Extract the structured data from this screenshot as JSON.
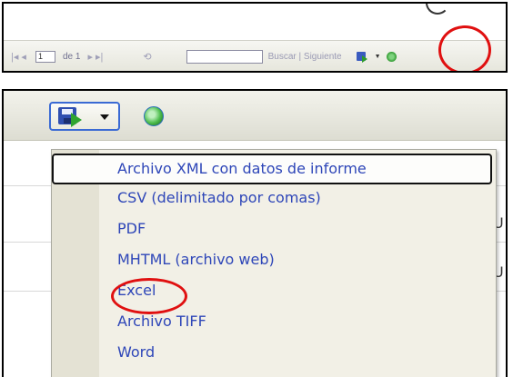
{
  "top_toolbar": {
    "nav_first_prev": "|◂  ◂",
    "page_value": "1",
    "page_of": "de 1",
    "nav_next_last": "▸  ▸|",
    "refresh_small": "⟲",
    "search_links": "Buscar | Siguiente"
  },
  "report_cells": {
    "row1_tail": "U",
    "row2_tail": "U"
  },
  "export_menu": {
    "items": [
      {
        "label": "Archivo XML con datos de informe"
      },
      {
        "label": "CSV (delimitado por comas)"
      },
      {
        "label": "PDF"
      },
      {
        "label": "MHTML (archivo web)"
      },
      {
        "label": "Excel"
      },
      {
        "label": "Archivo TIFF"
      },
      {
        "label": "Word"
      }
    ]
  },
  "colors": {
    "menu_text": "#2e46b8",
    "annotation_red": "#e01010",
    "menu_bg": "#f2f0e6"
  }
}
